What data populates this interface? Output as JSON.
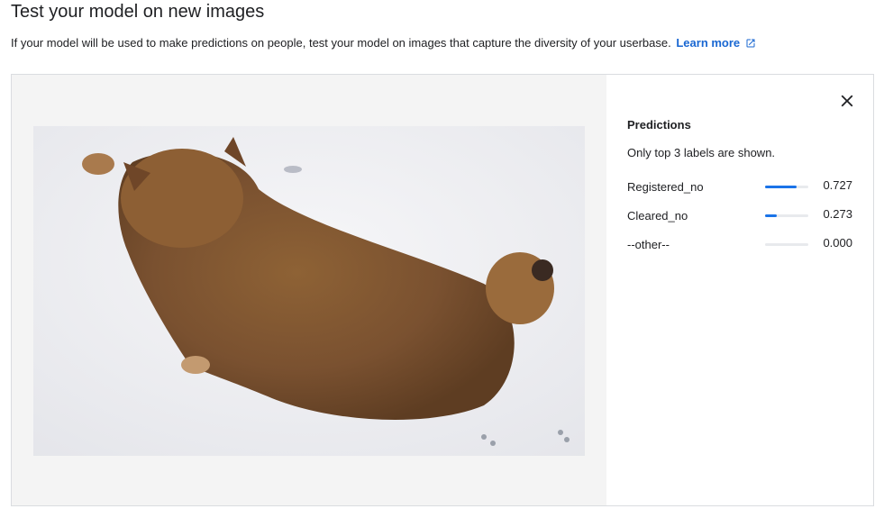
{
  "header": {
    "title": "Test your model on new images",
    "description": "If your model will be used to make predictions on people, test your model on images that capture the diversity of your userbase.",
    "learn_more": "Learn more"
  },
  "predictions": {
    "title": "Predictions",
    "subtitle": "Only top 3 labels are shown.",
    "items": [
      {
        "label": "Registered_no",
        "score": "0.727",
        "value": 0.727
      },
      {
        "label": "Cleared_no",
        "score": "0.273",
        "value": 0.273
      },
      {
        "label": "--other--",
        "score": "0.000",
        "value": 0.0
      }
    ]
  },
  "colors": {
    "accent": "#1a73e8",
    "link": "#1967d2"
  },
  "icons": {
    "close": "close-icon",
    "external": "external-link-icon"
  }
}
